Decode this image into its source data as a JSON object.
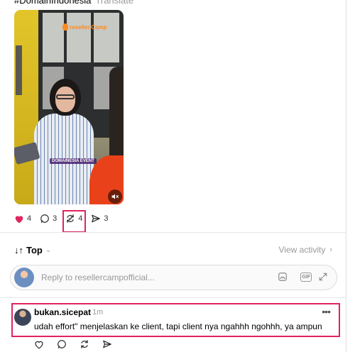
{
  "post": {
    "hashtag": "#DomainIndonesia",
    "translate_label": "Translate",
    "video": {
      "watermark": "reseller.Camp",
      "badge_text": "DOMAINESIA EVENT"
    },
    "actions": {
      "likes": "4",
      "replies": "3",
      "reposts": "4",
      "shares": "3"
    }
  },
  "replies_section": {
    "sort_label": "Top",
    "view_activity_label": "View activity",
    "reply_placeholder": "Reply to resellercampofficial...",
    "gif_label": "GIF"
  },
  "comment": {
    "username": "bukan.sicepat",
    "time": "1m",
    "text": "udah effort\" menjelaskan ke client, tapi client nya ngahhh ngohhh, ya ampun"
  },
  "colors": {
    "like_red": "#e0245e",
    "highlight_border": "#e0245e",
    "muted_text": "#999999"
  }
}
